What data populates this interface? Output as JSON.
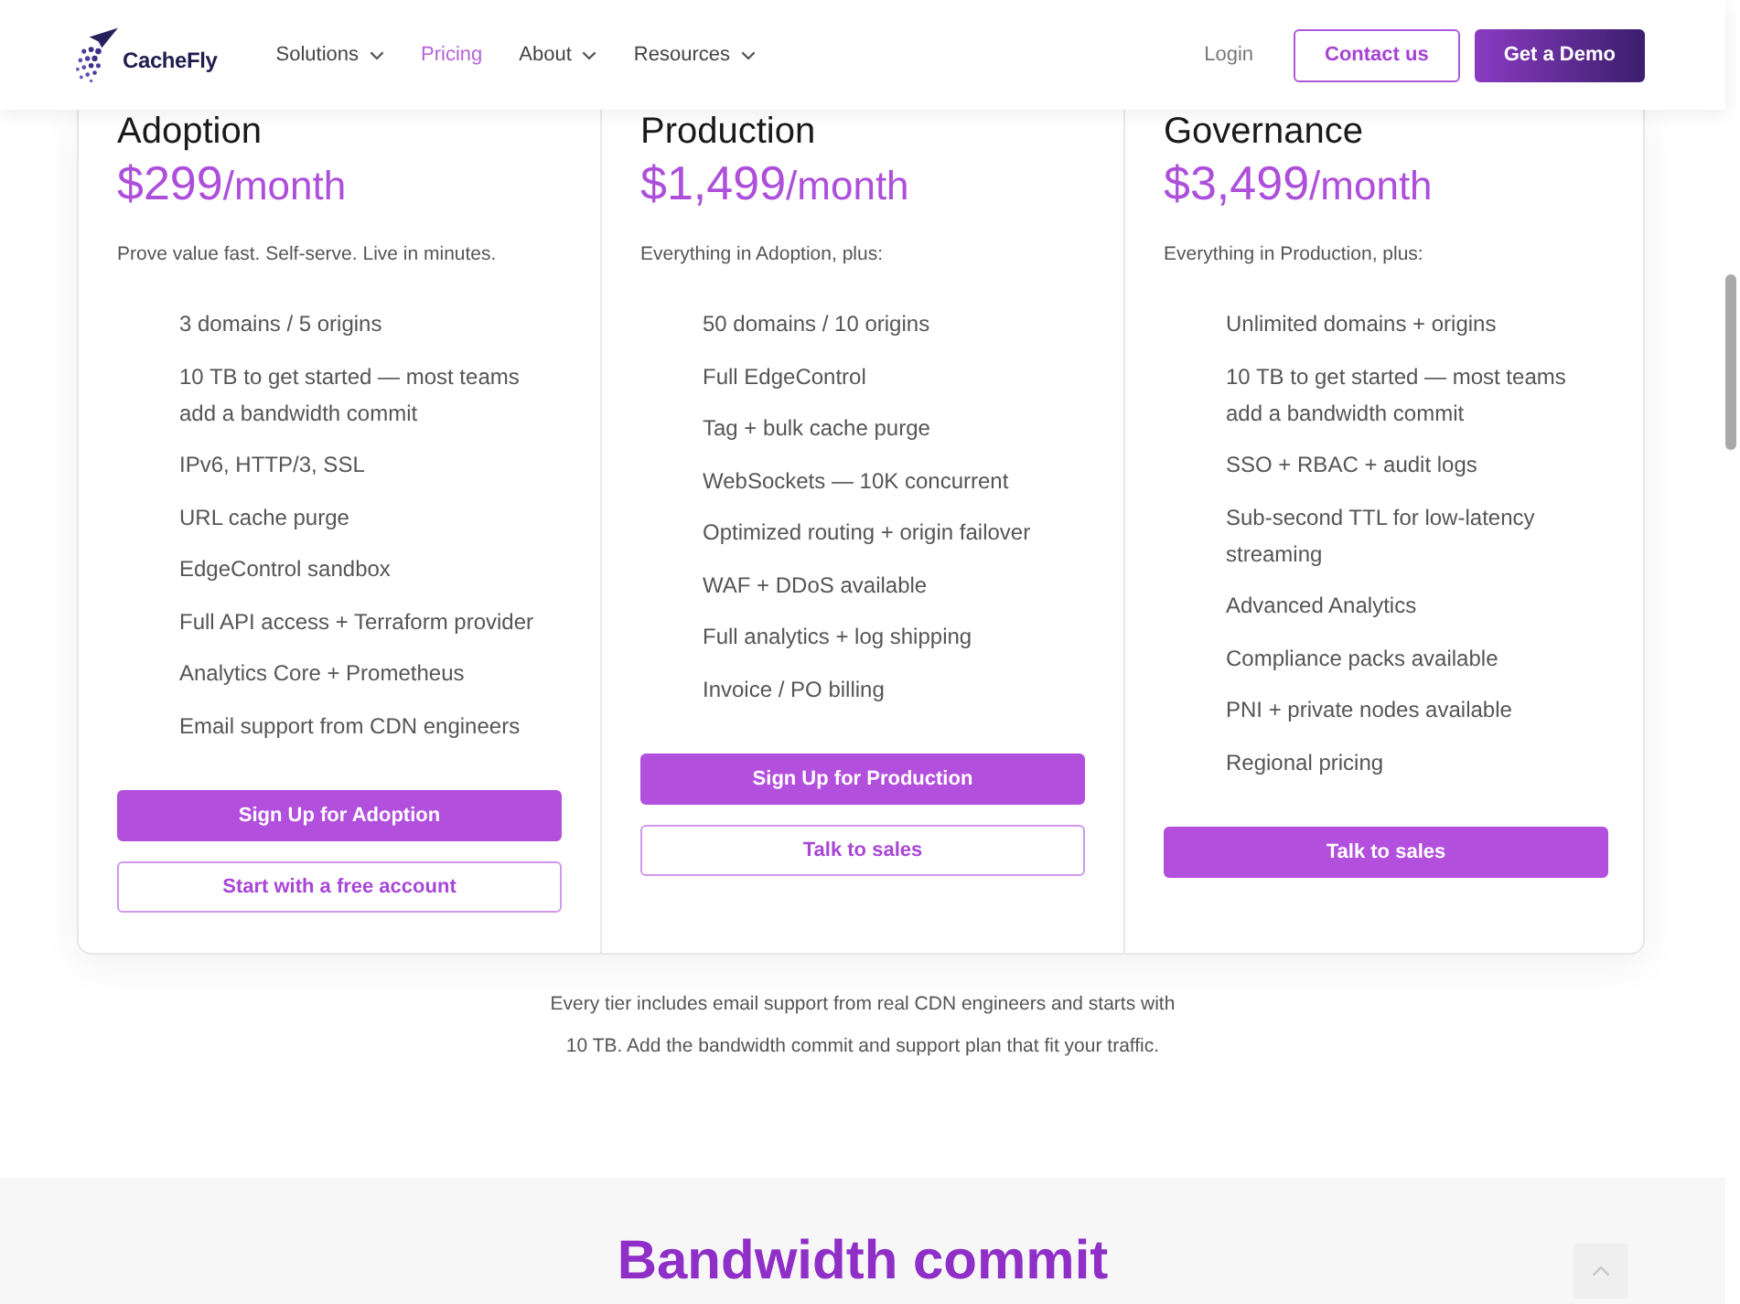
{
  "header": {
    "logo": {
      "text": "CacheFly"
    },
    "nav": [
      {
        "label": "Solutions",
        "selected": false,
        "has_menu": true
      },
      {
        "label": "Pricing",
        "selected": true,
        "has_menu": false
      },
      {
        "label": "About",
        "selected": false,
        "has_menu": true
      },
      {
        "label": "Resources",
        "selected": false,
        "has_menu": true
      }
    ],
    "login": "Login",
    "buttons": [
      {
        "label": "Contact us",
        "kind": "outline"
      },
      {
        "label": "Get a Demo",
        "kind": "gradient"
      }
    ]
  },
  "plans": [
    {
      "name": "Adoption",
      "price": "$299",
      "period": "/month",
      "summary": "Prove value fast. Self-serve. Live in minutes.",
      "features": [
        "3 domains / 5 origins",
        "10 TB to get started — most teams add a bandwidth commit",
        "IPv6, HTTP/3, SSL",
        "URL cache purge",
        "EdgeControl sandbox",
        "Full API access + Terraform provider",
        "Analytics Core + Prometheus",
        "Email support from CDN engineers"
      ],
      "buttons": [
        {
          "label": "Sign Up for Adoption",
          "kind": "solid"
        },
        {
          "label": "Start with a free account",
          "kind": "outline"
        }
      ]
    },
    {
      "name": "Production",
      "price": "$1,499",
      "period": "/month",
      "summary": "Everything in Adoption, plus:",
      "features": [
        "50 domains / 10 origins",
        "Full EdgeControl",
        "Tag + bulk cache purge",
        "WebSockets — 10K concurrent",
        "Optimized routing + origin failover",
        "WAF + DDoS available",
        "Full analytics + log shipping",
        "Invoice / PO billing"
      ],
      "buttons": [
        {
          "label": "Sign Up for Production",
          "kind": "solid"
        },
        {
          "label": "Talk to sales",
          "kind": "outline"
        }
      ]
    },
    {
      "name": "Governance",
      "price": "$3,499",
      "period": "/month",
      "summary": "Everything in Production, plus:",
      "features": [
        "Unlimited domains + origins",
        "10 TB to get started — most teams add a bandwidth commit",
        "SSO + RBAC + audit logs",
        "Sub-second TTL for low-latency streaming",
        "Advanced Analytics",
        "Compliance packs available",
        "PNI + private nodes available",
        "Regional pricing"
      ],
      "buttons": [
        {
          "label": "Talk to sales",
          "kind": "solid"
        }
      ]
    }
  ],
  "footnote": "Every tier includes email support from real CDN engineers and starts with 10 TB. Add the bandwidth commit and support plan that fit your traffic.",
  "next_section": {
    "title": "Bandwidth commit"
  }
}
